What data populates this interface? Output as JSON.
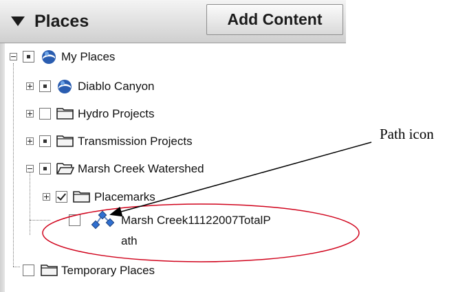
{
  "panel": {
    "title": "Places",
    "add_button_label": "Add Content"
  },
  "tree": {
    "items": [
      {
        "label": "My Places",
        "icon": "globe-icon",
        "expander": "minus",
        "checkbox": "partial"
      },
      {
        "label": "Diablo Canyon",
        "icon": "globe-icon",
        "expander": "plus",
        "checkbox": "partial"
      },
      {
        "label": "Hydro Projects",
        "icon": "folder-icon",
        "expander": "plus",
        "checkbox": "unchecked"
      },
      {
        "label": "Transmission Projects",
        "icon": "folder-icon",
        "expander": "plus",
        "checkbox": "partial"
      },
      {
        "label": "Marsh Creek Watershed",
        "icon": "folder-open-icon",
        "expander": "minus",
        "checkbox": "partial"
      },
      {
        "label": "Placemarks",
        "icon": "folder-icon",
        "expander": "plus",
        "checkbox": "checked"
      },
      {
        "label_line1": "Marsh Creek11122007TotalP",
        "label_line2": "ath",
        "icon": "path-icon",
        "checkbox": "unchecked"
      },
      {
        "label": "Temporary Places",
        "icon": "folder-icon",
        "checkbox": "unchecked"
      }
    ]
  },
  "annotation": {
    "text": "Path icon",
    "color": "#d0021b"
  }
}
